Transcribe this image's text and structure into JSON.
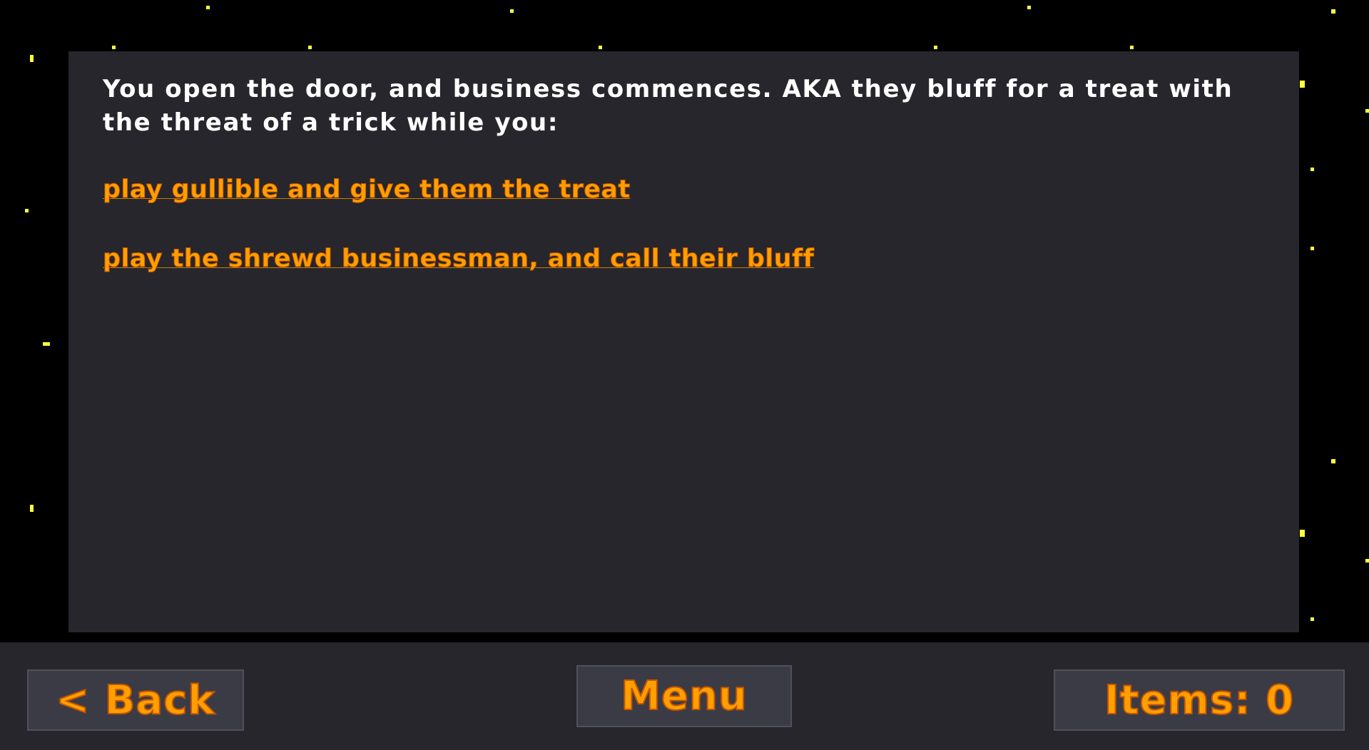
{
  "story": {
    "text": "You open the door, and business commences. AKA they bluff for a treat with the threat of a trick while you:"
  },
  "choices": [
    {
      "label": "play gullible and give them the treat"
    },
    {
      "label": "play the shrewd businessman, and call their bluff"
    }
  ],
  "nav": {
    "back_label": "< Back",
    "menu_label": "Menu",
    "items_label": "Items: 0"
  },
  "colors": {
    "background": "#000000",
    "panel": "#26262c",
    "button": "#3b3b45",
    "accent": "#ff9f00",
    "star": "#ffff3c",
    "text": "#ffffff"
  }
}
